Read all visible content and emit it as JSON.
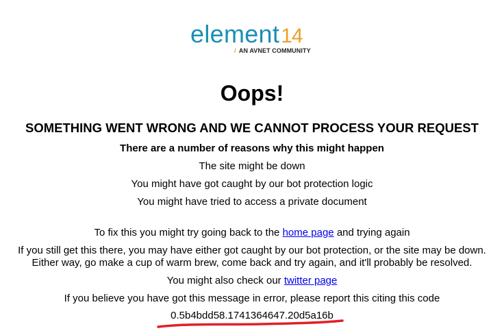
{
  "logo": {
    "word": "element",
    "number": "14",
    "tagline_slash": "/",
    "tagline": "AN AVNET COMMUNITY",
    "brand_color": "#1a8fb3",
    "accent_color": "#e9a02a"
  },
  "error": {
    "title": "Oops!",
    "headline": "SOMETHING WENT WRONG AND WE CANNOT PROCESS YOUR REQUEST",
    "reasons_heading": "There are a number of reasons why this might happen",
    "reasons": [
      "The site might be down",
      "You might have got caught by our bot protection logic",
      "You might have tried to access a private document"
    ],
    "fix_prefix": "To fix this you might try going back to the",
    "home_link": "home page",
    "fix_suffix": "and trying again",
    "still_line1": "If you still get this there, you may have either got caught by our bot protection, or the site may be down.",
    "still_line2": "Either way, go make a cup of warm brew, come back and try again, and it'll probably be resolved.",
    "check_prefix": "You might also check our",
    "twitter_link": "twitter page",
    "report_line": "If you believe you have got this message in error, please report this citing this code",
    "code": "0.5b4bdd58.1741364647.20d5a16b",
    "annotation_color": "#e0202a",
    "link_color": "#0000ee"
  }
}
